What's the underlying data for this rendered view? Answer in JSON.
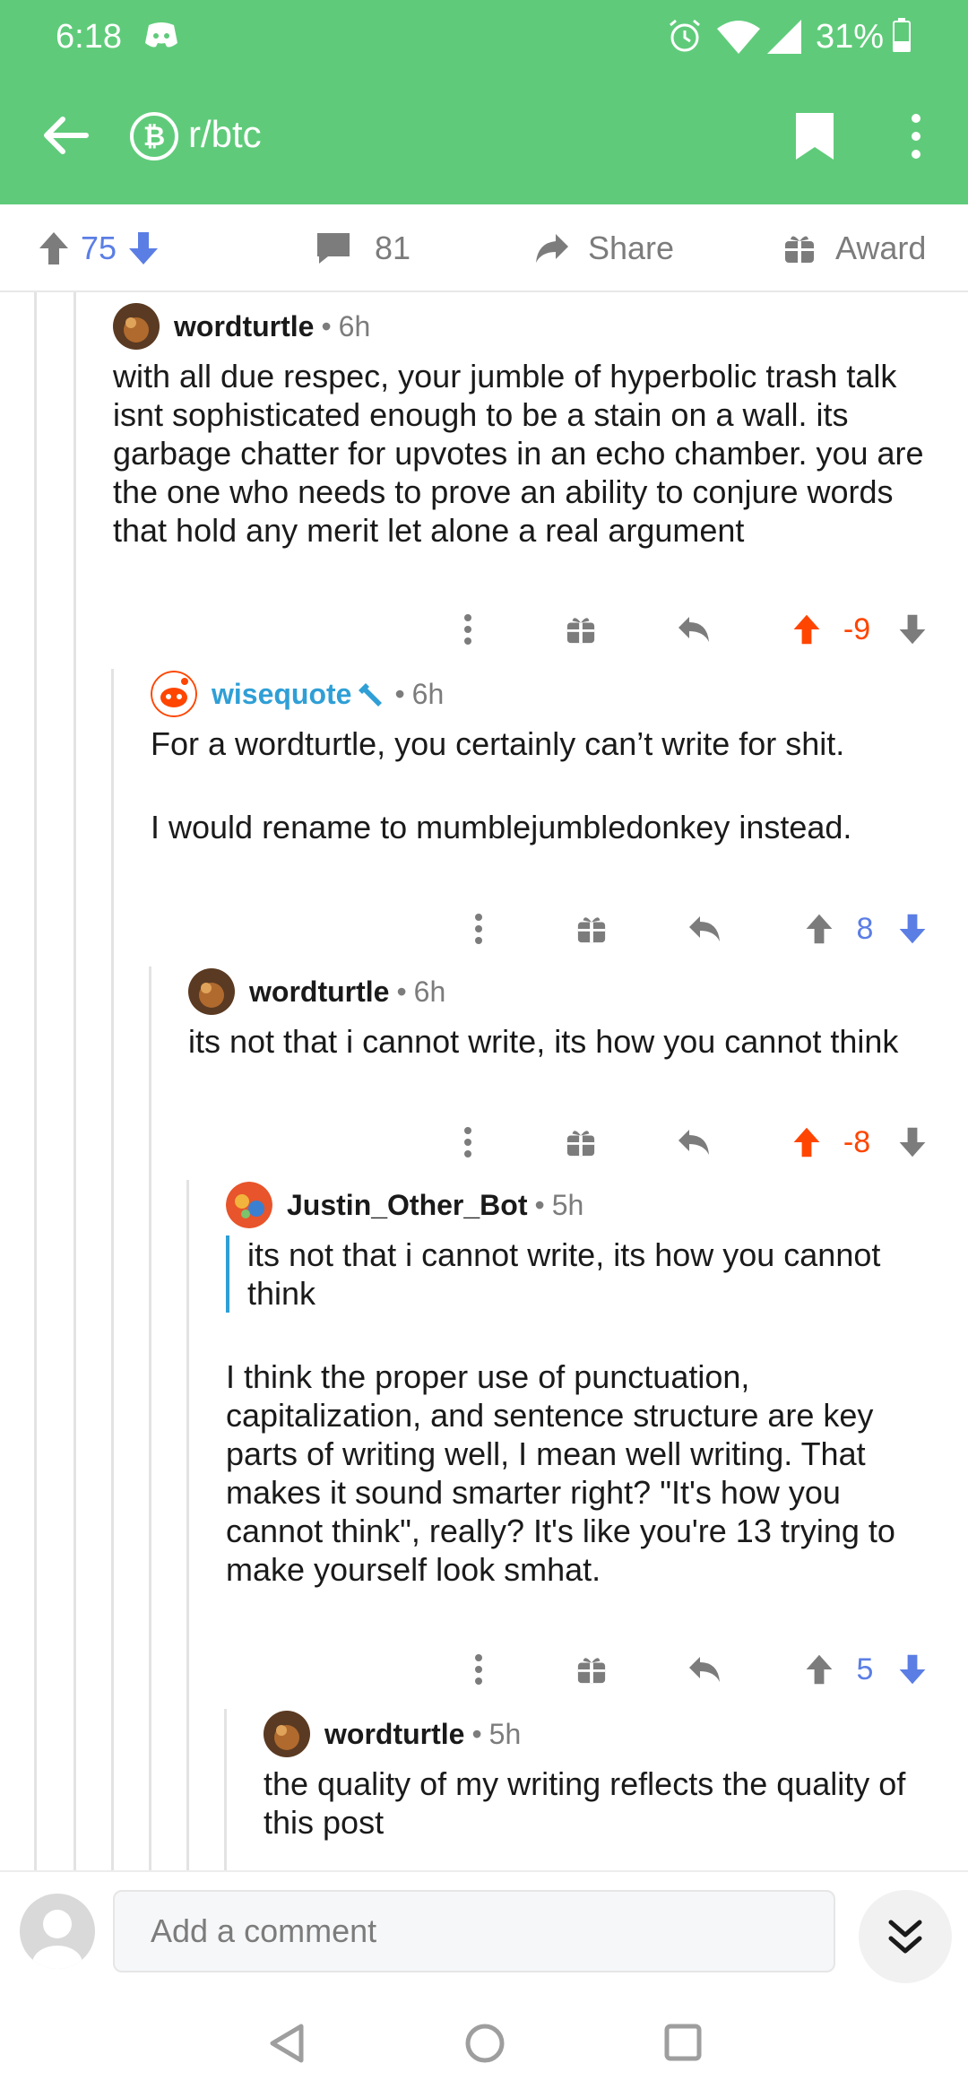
{
  "status_bar": {
    "time": "6:18",
    "battery": "31%"
  },
  "app_bar": {
    "subreddit": "r/btc"
  },
  "post_actions": {
    "score": "75",
    "comments": "81",
    "share": "Share",
    "award": "Award"
  },
  "comments": [
    {
      "author": "wordturtle",
      "age": "6h",
      "body": [
        "with all due respec, your jumble of hyperbolic trash talk isnt sophisticated enough to be a stain on a wall.  its garbage chatter for upvotes in an echo chamber.  you are the one who needs to prove an ability to conjure words that hold any merit let alone a real argument"
      ],
      "score": "-9",
      "vote": "up"
    },
    {
      "author": "wisequote",
      "age": "6h",
      "body": [
        "For a wordturtle, you certainly can’t write for shit.",
        "I would rename to mumblejumbledonkey instead."
      ],
      "score": "8",
      "vote": "down"
    },
    {
      "author": "wordturtle",
      "age": "6h",
      "body": [
        "its not that i cannot write, its how you cannot think"
      ],
      "score": "-8",
      "vote": "up"
    },
    {
      "author": "Justin_Other_Bot",
      "age": "5h",
      "quote": "its not that i cannot write, its how you cannot think",
      "body": [
        "I think the proper use of punctuation, capitalization, and sentence structure are key parts of writing well, I mean well writing. That makes it sound smarter right? \"It's how you cannot think\", really? It's like you're 13 trying to make yourself look smhat."
      ],
      "score": "5",
      "vote": "down"
    },
    {
      "author": "wordturtle",
      "age": "5h",
      "body": [
        "the quality of my writing reflects the quality of this post"
      ]
    }
  ],
  "composer": {
    "placeholder": "Add a comment"
  },
  "colors": {
    "header": "#5fcb7a",
    "upvote": "#ff4500",
    "downvote": "#5b7ee5",
    "mod_name": "#2f9fd6"
  }
}
